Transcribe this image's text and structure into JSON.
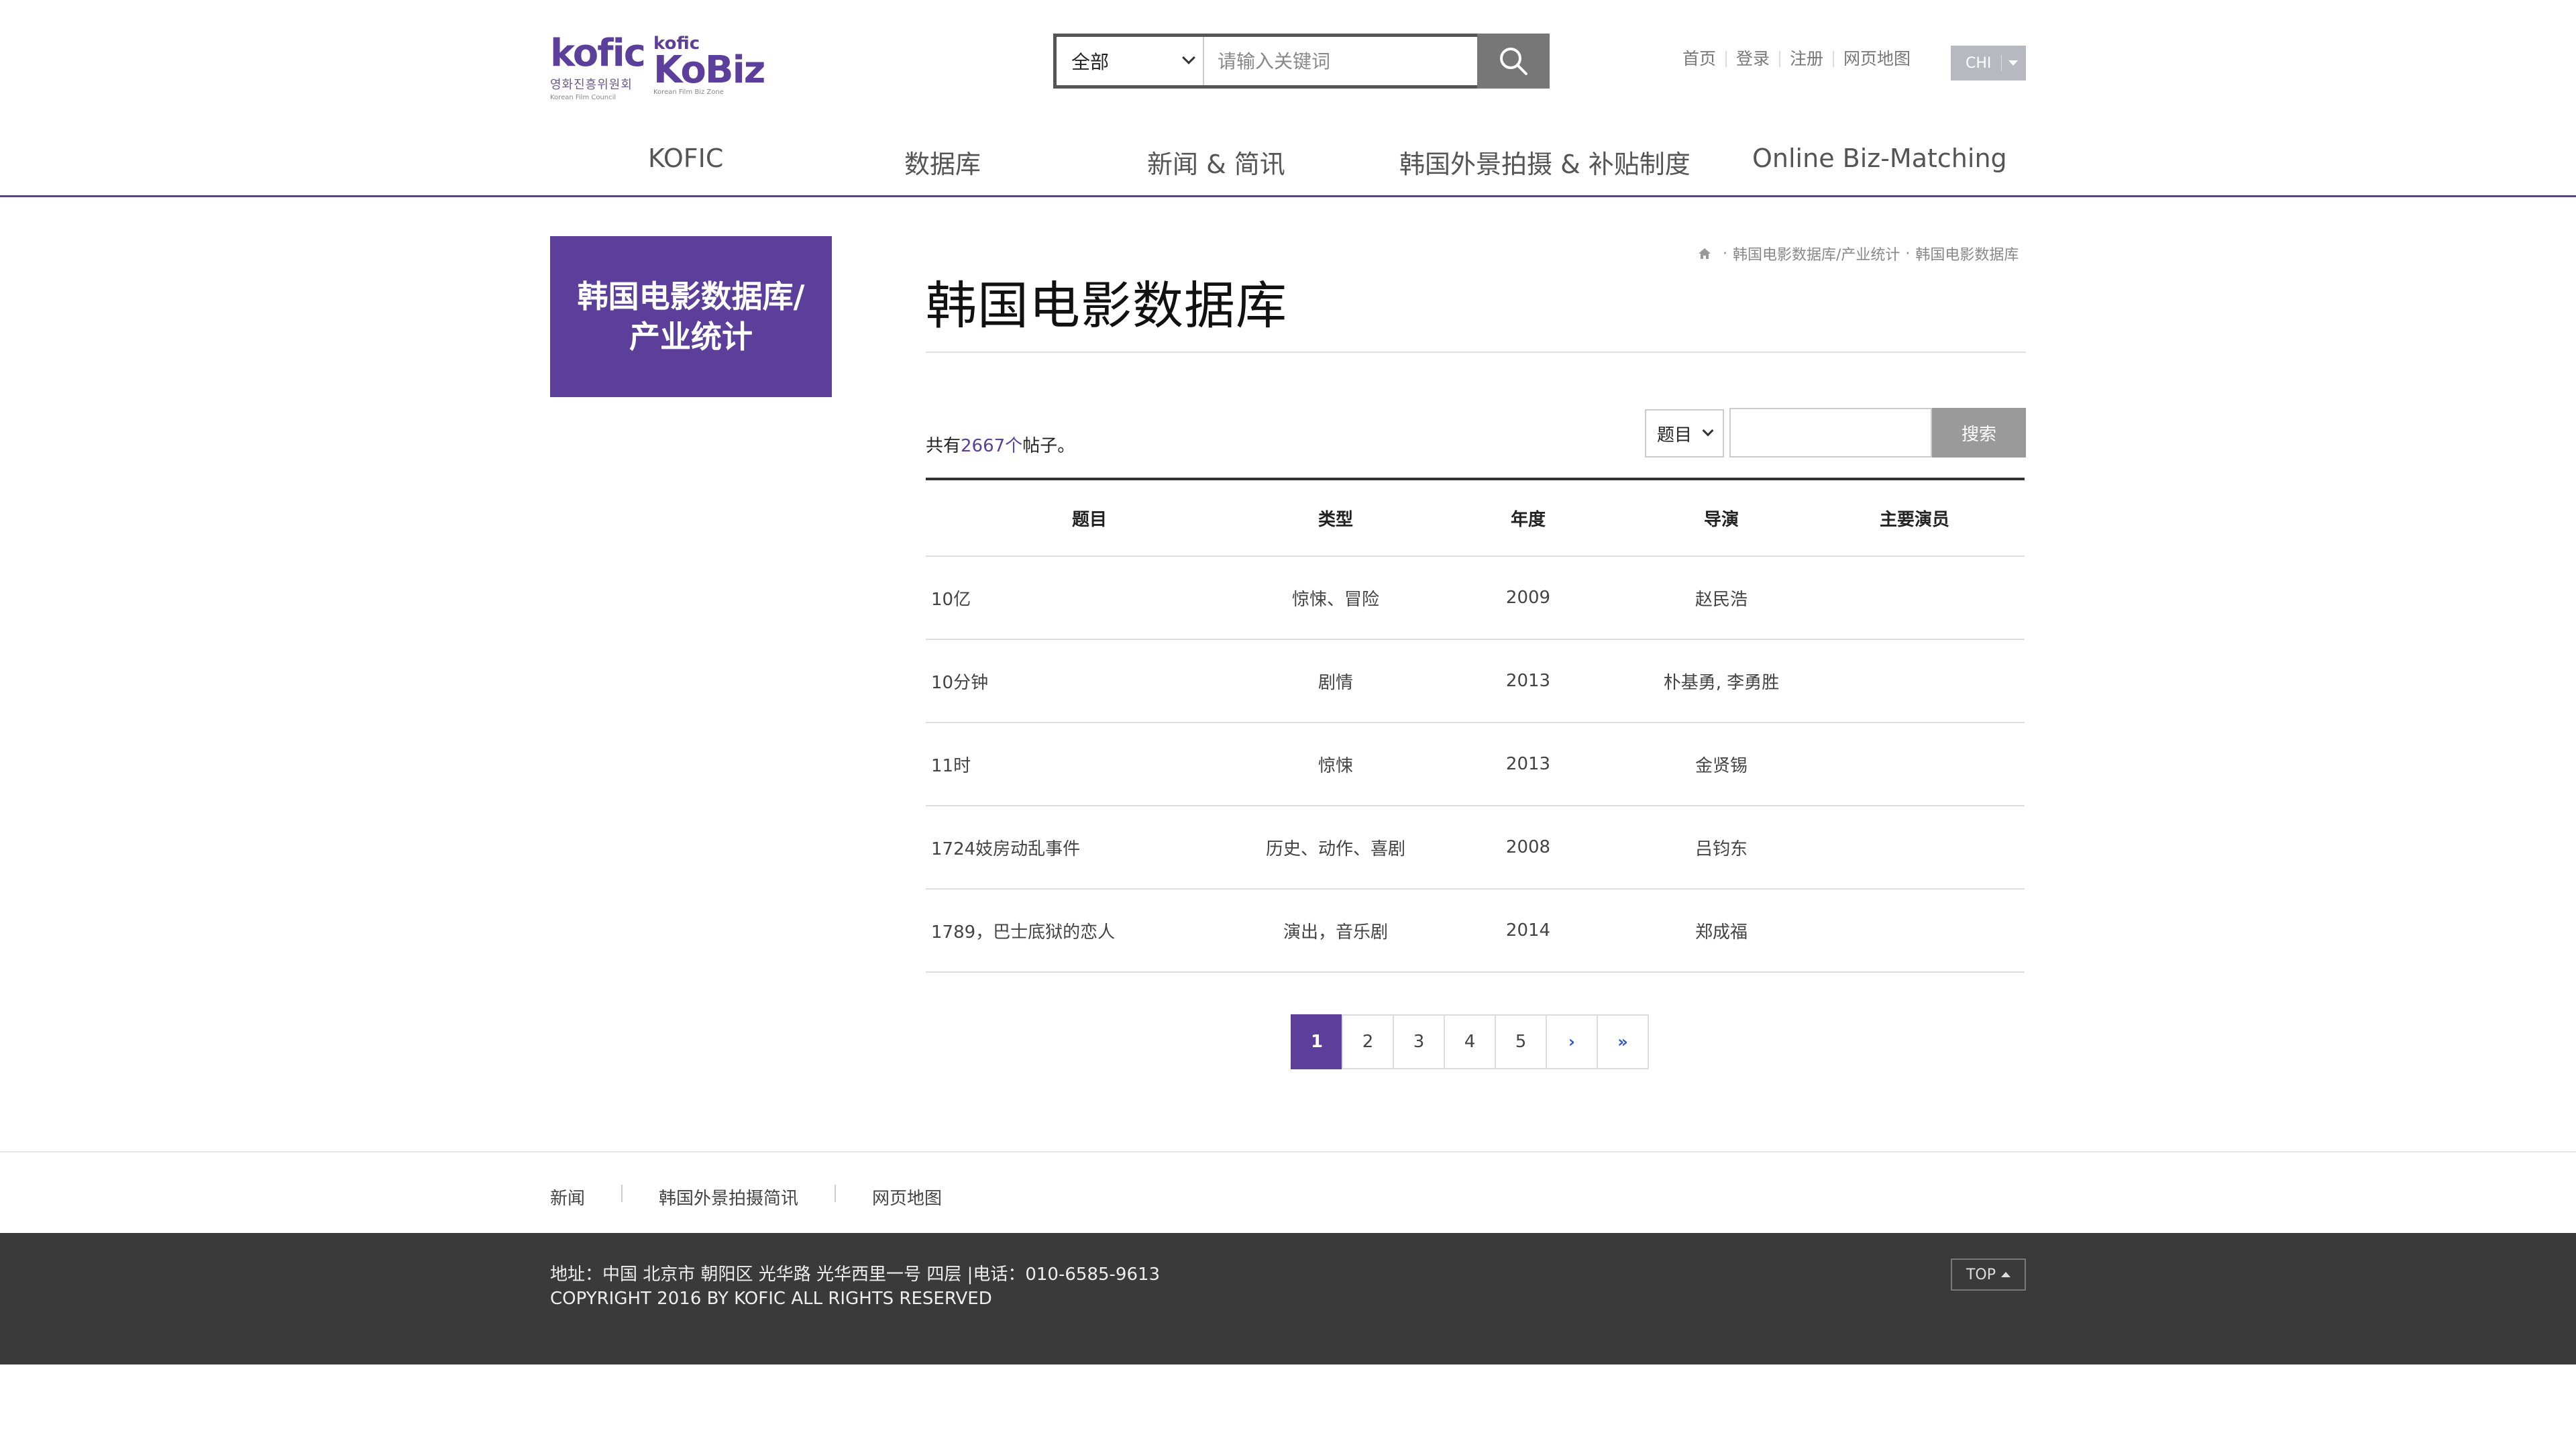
{
  "header": {
    "logo_kofic": {
      "word": "kofic",
      "korean": "영화진흥위원회",
      "english": "Korean Film Council"
    },
    "logo_kobiz": {
      "small": "kofic",
      "word": "KoBiz",
      "english": "Korean Film Biz Zone"
    },
    "search": {
      "scope": "全部",
      "placeholder": "请输入关键词"
    },
    "util_links": [
      "首页",
      "登录",
      "注册",
      "网页地图"
    ],
    "lang": "CHI",
    "nav": [
      "KOFIC",
      "数据库",
      "新闻 & 简讯",
      "韩国外景拍摄 & 补贴制度",
      "Online Biz-Matching"
    ]
  },
  "sidebar": {
    "title": "韩国电影数据库/产业统计"
  },
  "breadcrumb": [
    "韩国电影数据库/产业统计",
    "韩国电影数据库"
  ],
  "page_title": "韩国电影数据库",
  "count": {
    "prefix": "共有",
    "number": "2667个",
    "suffix": "帖子。"
  },
  "filter": {
    "select": "题目",
    "button": "搜索",
    "input_value": ""
  },
  "table": {
    "headers": [
      "题目",
      "类型",
      "年度",
      "导演",
      "主要演员"
    ],
    "rows": [
      [
        "10亿",
        "惊悚、冒险",
        "2009",
        "赵民浩",
        ""
      ],
      [
        "10分钟",
        "剧情",
        "2013",
        "朴基勇, 李勇胜",
        ""
      ],
      [
        "11时",
        "惊悚",
        "2013",
        "金贤锡",
        ""
      ],
      [
        "1724妓房动乱事件",
        "历史、动作、喜剧",
        "2008",
        "吕钧东",
        ""
      ],
      [
        "1789，巴士底狱的恋人",
        "演出，音乐剧",
        "2014",
        "郑成福",
        ""
      ]
    ]
  },
  "pagination": {
    "pages": [
      "1",
      "2",
      "3",
      "4",
      "5"
    ],
    "active": "1",
    "next": "›",
    "last": "»"
  },
  "footer": {
    "links": [
      "新闻",
      "韩国外景拍摄简讯",
      "网页地图"
    ],
    "address": "地址：中国 北京市 朝阳区 光华路 光华西里一号 四层  |电话：010-6585-9613",
    "copyright": "COPYRIGHT 2016 BY KOFIC ALL RIGHTS RESERVED",
    "top": "TOP"
  },
  "colors": {
    "brand": "#5b3f9a",
    "footer_bg": "#3a3a3a"
  },
  "icons": [
    "search-icon",
    "home-icon",
    "chevron-down-icon",
    "caret-up-icon"
  ]
}
